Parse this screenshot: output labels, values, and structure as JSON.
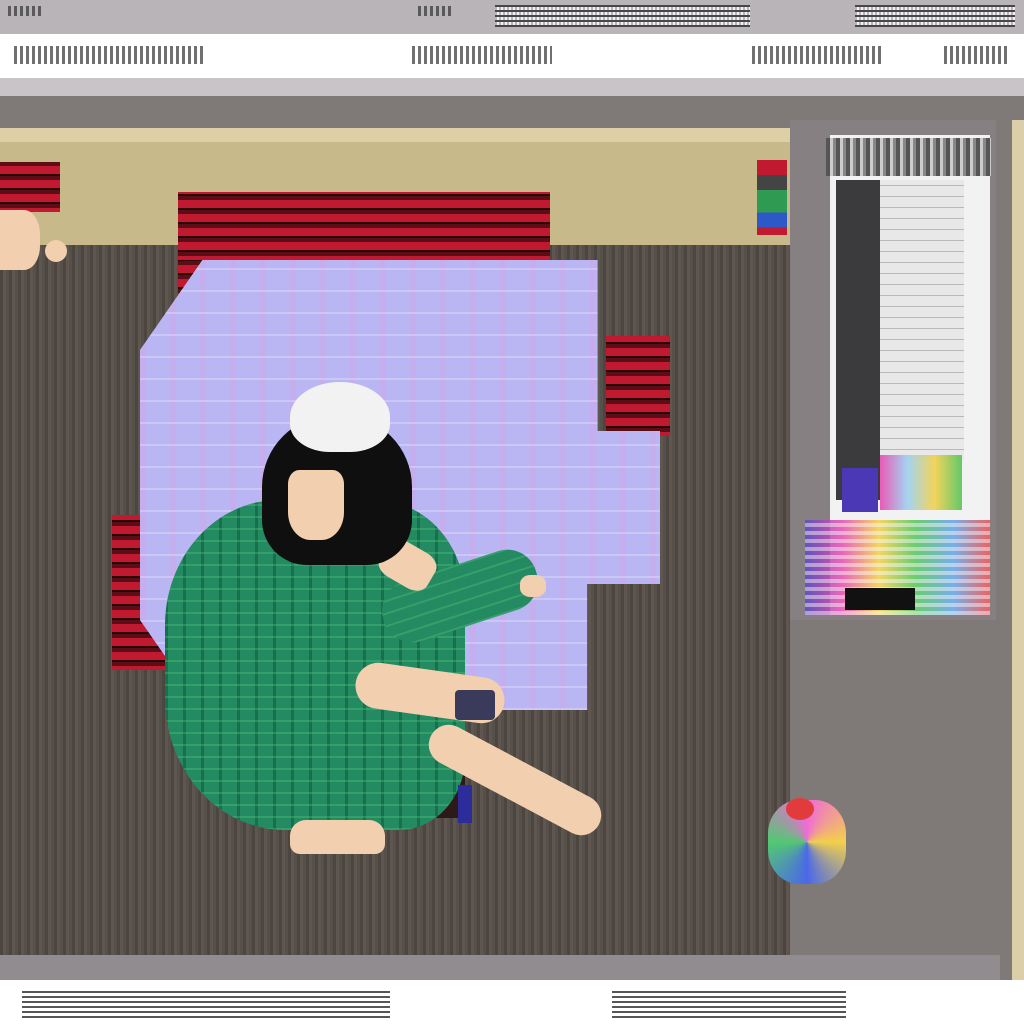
{
  "header": {
    "left_label": "",
    "center_label": "",
    "right_label": ""
  },
  "scene": {
    "description": "",
    "colors": {
      "wall": "#c7b98a",
      "floor": "#4d4540",
      "plaid": "#c01930",
      "screen": "#b9b6f3",
      "robe": "#248a62",
      "hair": "#0f0f10",
      "skin": "#f1cfaf"
    }
  },
  "panel": {
    "text_top": "",
    "text_bottom": ""
  },
  "footer": {
    "left_label": "",
    "right_label": ""
  }
}
